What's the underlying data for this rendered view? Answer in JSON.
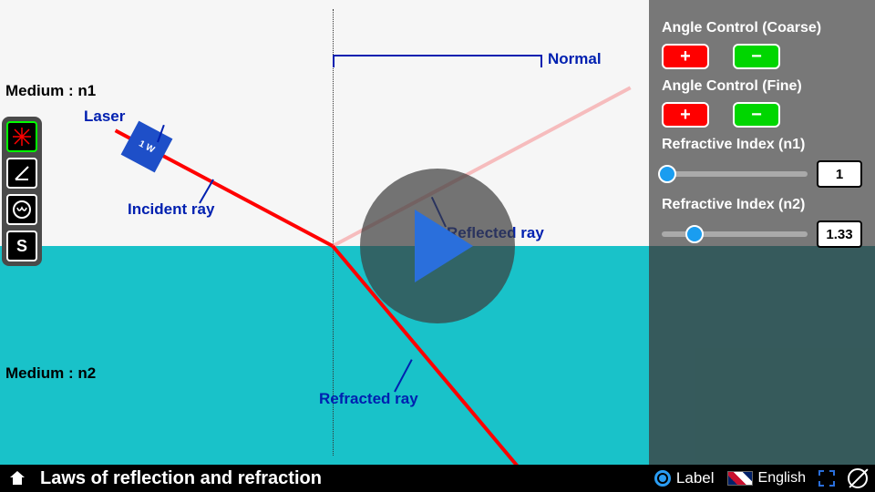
{
  "title": "Laws of reflection and refraction",
  "normal_label": "Normal",
  "laser_label": "Laser",
  "laser_power": "1 W",
  "incident_label": "Incident\nray",
  "reflected_label": "Reflected\nray",
  "refracted_label": "Refracted\nray",
  "medium1_label": "Medium : n1",
  "medium2_label": "Medium : n2",
  "panel": {
    "coarse": "Angle Control (Coarse)",
    "fine": "Angle Control (Fine)",
    "n1_label": "Refractive Index (n1)",
    "n2_label": "Refractive Index (n2)",
    "plus": "+",
    "minus": "−",
    "n1_value": "1",
    "n2_value": "1.33"
  },
  "bottom": {
    "label_toggle": "Label",
    "language": "English"
  },
  "tools": {
    "s": "S"
  }
}
